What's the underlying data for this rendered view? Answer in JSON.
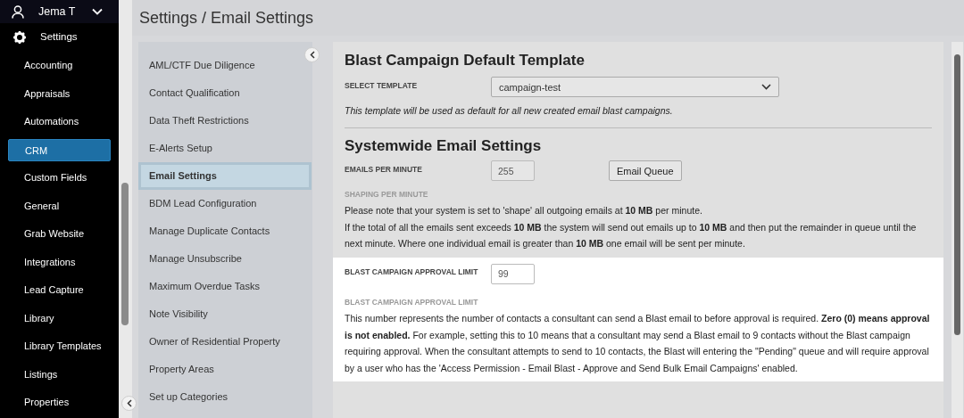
{
  "user": {
    "name": "Jema T"
  },
  "sidebar": {
    "section": "Settings",
    "items": [
      {
        "label": "Accounting",
        "selected": false
      },
      {
        "label": "Appraisals",
        "selected": false
      },
      {
        "label": "Automations",
        "selected": false
      },
      {
        "label": "CRM",
        "selected": true
      },
      {
        "label": "Custom Fields",
        "selected": false
      },
      {
        "label": "General",
        "selected": false
      },
      {
        "label": "Grab Website",
        "selected": false
      },
      {
        "label": "Integrations",
        "selected": false
      },
      {
        "label": "Lead Capture",
        "selected": false
      },
      {
        "label": "Library",
        "selected": false
      },
      {
        "label": "Library Templates",
        "selected": false
      },
      {
        "label": "Listings",
        "selected": false
      },
      {
        "label": "Properties",
        "selected": false
      }
    ]
  },
  "page_title": "Settings / Email Settings",
  "settings_menu": {
    "items": [
      {
        "label": "AML/CTF Due Diligence",
        "selected": false
      },
      {
        "label": "Contact Qualification",
        "selected": false
      },
      {
        "label": "Data Theft Restrictions",
        "selected": false
      },
      {
        "label": "E-Alerts Setup",
        "selected": false
      },
      {
        "label": "Email Settings",
        "selected": true
      },
      {
        "label": "BDM Lead Configuration",
        "selected": false
      },
      {
        "label": "Manage Duplicate Contacts",
        "selected": false
      },
      {
        "label": "Manage Unsubscribe",
        "selected": false
      },
      {
        "label": "Maximum Overdue Tasks",
        "selected": false
      },
      {
        "label": "Note Visibility",
        "selected": false
      },
      {
        "label": "Owner of Residential Property",
        "selected": false
      },
      {
        "label": "Property Areas",
        "selected": false
      },
      {
        "label": "Set up Categories",
        "selected": false
      }
    ]
  },
  "template_section": {
    "heading": "Blast Campaign Default Template",
    "select_label": "SELECT TEMPLATE",
    "select_value": "campaign-test",
    "note": "This template will be used as default for all new created email blast campaigns."
  },
  "systemwide_section": {
    "heading": "Systemwide Email Settings",
    "emails_label": "EMAILS PER MINUTE",
    "emails_value": "255",
    "queue_button": "Email Queue",
    "shaping_label": "SHAPING PER MINUTE",
    "shaping_text": [
      "Please note that your system is set to 'shape' all outgoing emails at **10 MB** per minute.",
      "If the total of all the emails sent exceeds **10 MB** the system will send out emails up to **10 MB** and then put the remainder in queue until the next minute. Where one individual email is greater than **10 MB** one email will be sent per minute."
    ]
  },
  "approval_section": {
    "highlighted": true,
    "label": "BLAST CAMPAIGN APPROVAL LIMIT",
    "value": "99",
    "help_label": "BLAST CAMPAIGN APPROVAL LIMIT",
    "help_text": "This number represents the number of contacts a consultant can send a Blast email to before approval is required. **Zero (0) means approval is not enabled.** For example, setting this to 10 means that a consultant may send a Blast email to 9 contacts without the Blast campaign requiring approval. When the consultant attempts to send to 10 contacts, the Blast will entering the \"Pending\" queue and will require approval by a user who has the 'Access Permission - Email Blast - Approve and Send Bulk Email Campaigns' enabled."
  }
}
